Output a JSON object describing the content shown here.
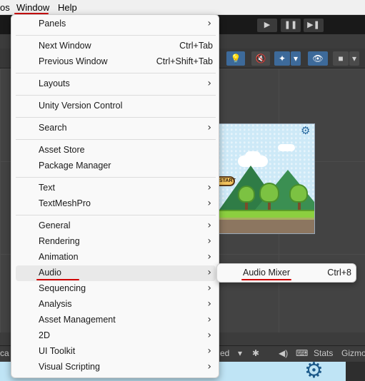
{
  "menubar": {
    "prev_item": "os",
    "window": "Window",
    "help": "Help"
  },
  "toolbar": {
    "play": "▶",
    "pause": "❚❚",
    "step": "▶❚"
  },
  "scene_toolbar": {
    "light": "💡",
    "audio": "🔇",
    "fx": "✦",
    "visibility": "👁",
    "camera": "■",
    "dropdown": "▾"
  },
  "game_view": {
    "start_sign": "START"
  },
  "bottom_bar": {
    "left_text": "ca",
    "mid_text": "ed",
    "stats": "Stats",
    "gizmos": "Gizmo"
  },
  "window_menu": {
    "items": [
      {
        "label": "Panels",
        "submenu": true
      },
      {
        "label": "Next Window",
        "shortcut": "Ctrl+Tab"
      },
      {
        "label": "Previous Window",
        "shortcut": "Ctrl+Shift+Tab"
      },
      {
        "label": "Layouts",
        "submenu": true
      },
      {
        "label": "Unity Version Control"
      },
      {
        "label": "Search",
        "submenu": true
      },
      {
        "label": "Asset Store"
      },
      {
        "label": "Package Manager"
      },
      {
        "label": "Text",
        "submenu": true
      },
      {
        "label": "TextMeshPro",
        "submenu": true
      },
      {
        "label": "General",
        "submenu": true
      },
      {
        "label": "Rendering",
        "submenu": true
      },
      {
        "label": "Animation",
        "submenu": true
      },
      {
        "label": "Audio",
        "submenu": true,
        "highlighted": true
      },
      {
        "label": "Sequencing",
        "submenu": true
      },
      {
        "label": "Analysis",
        "submenu": true
      },
      {
        "label": "Asset Management",
        "submenu": true
      },
      {
        "label": "2D",
        "submenu": true
      },
      {
        "label": "UI Toolkit",
        "submenu": true
      },
      {
        "label": "Visual Scripting",
        "submenu": true
      }
    ],
    "arrow_glyph": "›"
  },
  "audio_submenu": {
    "label": "Audio Mixer",
    "shortcut": "Ctrl+8"
  },
  "colors": {
    "annotation_underline": "#d00000",
    "menu_bg": "#f9f9f9",
    "hover_bg": "#e9e9e9"
  }
}
